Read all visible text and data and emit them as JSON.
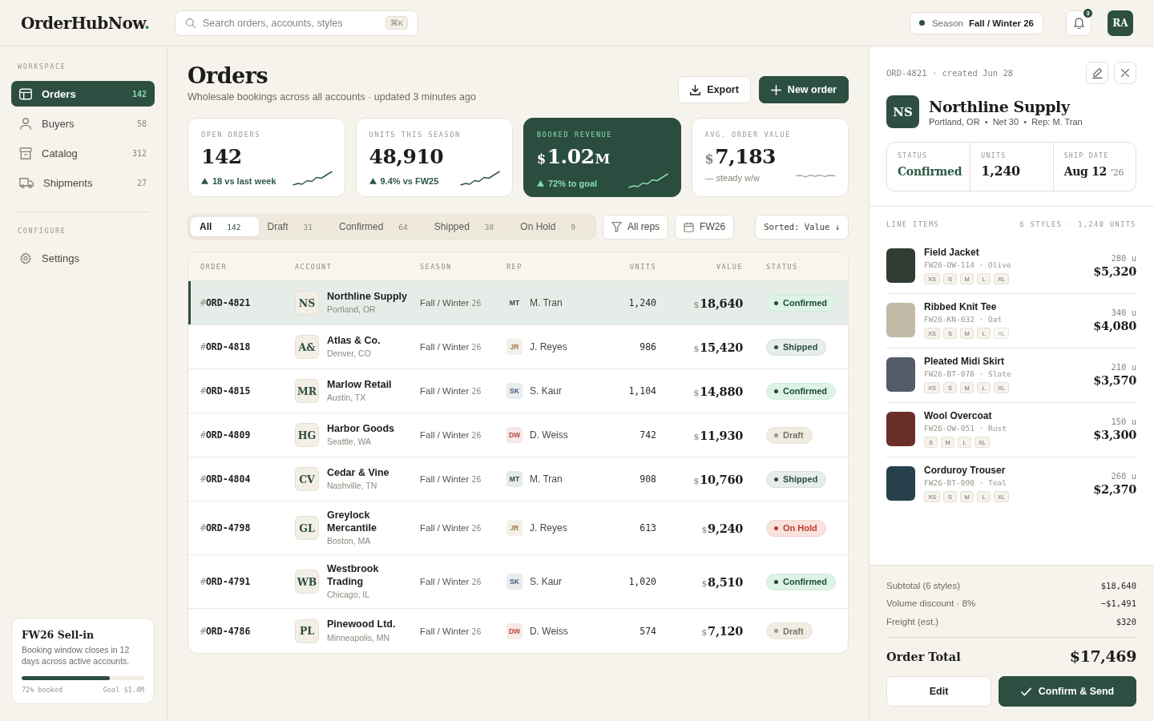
{
  "top_bar": {
    "logo": {
      "name": "OrderHubNow",
      "dot": "."
    },
    "search": {
      "placeholder": "Search orders, accounts, styles",
      "shortcut": "⌘K"
    },
    "season": {
      "label": "Season",
      "value": "Fall / Winter 26"
    },
    "notifications": {
      "count": "3"
    },
    "user": {
      "initials": "RA"
    }
  },
  "sidebar": {
    "sections": [
      {
        "title": "WORKSPACE",
        "items": [
          {
            "label": "Orders",
            "count": "142",
            "selected": true
          },
          {
            "label": "Buyers",
            "count": "58",
            "selected": false
          },
          {
            "label": "Catalog",
            "count": "312",
            "selected": false
          },
          {
            "label": "Shipments",
            "count": "27",
            "selected": false
          }
        ]
      },
      {
        "title": "CONFIGURE",
        "items": [
          {
            "label": "Settings",
            "selected": false
          }
        ]
      }
    ],
    "promo": {
      "title": "FW26 Sell-in",
      "text": "Booking window closes in 12 days across active accounts.",
      "level": 0.72,
      "progress_label": "72% booked",
      "goal": "Goal $1.4M"
    }
  },
  "page": {
    "title": "Orders",
    "subtitle": "Wholesale bookings across all accounts · updated 3 minutes ago",
    "actions": [
      {
        "label": "Export",
        "kind": "export"
      },
      {
        "label": "New order",
        "kind": "create"
      }
    ]
  },
  "kpis": [
    {
      "label": "OPEN ORDERS",
      "value": "142",
      "change": "18 vs last week",
      "kind": "up",
      "highlighted": false
    },
    {
      "label": "UNITS THIS SEASON",
      "value": "48,910",
      "change": "9.4% vs FW25",
      "kind": "up",
      "highlighted": false
    },
    {
      "label": "BOOKED REVENUE",
      "prefix": "$",
      "value": "1.02",
      "suffix": "M",
      "change": "72% to goal",
      "kind": "up",
      "highlighted": true
    },
    {
      "label": "AVG. ORDER VALUE",
      "prefix": "$",
      "value": "7,183",
      "change": "— steady w/w",
      "kind": "flat",
      "highlighted": false
    }
  ],
  "filters": {
    "tabs": [
      {
        "label": "All",
        "count": "142",
        "selected": true
      },
      {
        "label": "Draft",
        "count": "31",
        "selected": false
      },
      {
        "label": "Confirmed",
        "count": "64",
        "selected": false
      },
      {
        "label": "Shipped",
        "count": "38",
        "selected": false
      },
      {
        "label": "On Hold",
        "count": "9",
        "selected": false
      }
    ],
    "buttons": [
      {
        "label": "All reps",
        "kind": "filter"
      },
      {
        "label": "FW26",
        "kind": "date"
      },
      {
        "label": "Sorted: Value ↓",
        "kind": "sort"
      }
    ]
  },
  "table": {
    "columns": [
      "ORDER",
      "ACCOUNT",
      "SEASON",
      "REP",
      "UNITS",
      "VALUE",
      "STATUS"
    ],
    "rows": [
      {
        "order": {
          "prefix": "#",
          "id": "ORD-4821"
        },
        "account": {
          "initials": "NS",
          "name": "Northline Supply",
          "location": "Portland, OR"
        },
        "season": {
          "name": "Fall / Winter",
          "year": "26"
        },
        "rep": {
          "initials": "MT",
          "name": "M. Tran",
          "color": "#2c4f41"
        },
        "units": "1,240",
        "value": {
          "currency": "$",
          "amount": "18,640"
        },
        "status": {
          "label": "Confirmed",
          "kind": "confirmed"
        },
        "selected": true
      },
      {
        "order": {
          "prefix": "#",
          "id": "ORD-4818"
        },
        "account": {
          "initials": "A&",
          "name": "Atlas & Co.",
          "location": "Denver, CO"
        },
        "season": {
          "name": "Fall / Winter",
          "year": "26"
        },
        "rep": {
          "initials": "JR",
          "name": "J. Reyes",
          "color": "#9a7a45"
        },
        "units": "986",
        "value": {
          "currency": "$",
          "amount": "15,420"
        },
        "status": {
          "label": "Shipped",
          "kind": "shipped"
        },
        "selected": false
      },
      {
        "order": {
          "prefix": "#",
          "id": "ORD-4815"
        },
        "account": {
          "initials": "MR",
          "name": "Marlow Retail",
          "location": "Austin, TX"
        },
        "season": {
          "name": "Fall / Winter",
          "year": "26"
        },
        "rep": {
          "initials": "SK",
          "name": "S. Kaur",
          "color": "#3f5d78"
        },
        "units": "1,104",
        "value": {
          "currency": "$",
          "amount": "14,880"
        },
        "status": {
          "label": "Confirmed",
          "kind": "confirmed"
        },
        "selected": false
      },
      {
        "order": {
          "prefix": "#",
          "id": "ORD-4809"
        },
        "account": {
          "initials": "HG",
          "name": "Harbor Goods",
          "location": "Seattle, WA"
        },
        "season": {
          "name": "Fall / Winter",
          "year": "26"
        },
        "rep": {
          "initials": "DW",
          "name": "D. Weiss",
          "color": "#b5483c"
        },
        "units": "742",
        "value": {
          "currency": "$",
          "amount": "11,930"
        },
        "status": {
          "label": "Draft",
          "kind": "draft"
        },
        "selected": false
      },
      {
        "order": {
          "prefix": "#",
          "id": "ORD-4804"
        },
        "account": {
          "initials": "CV",
          "name": "Cedar & Vine",
          "location": "Nashville, TN"
        },
        "season": {
          "name": "Fall / Winter",
          "year": "26"
        },
        "rep": {
          "initials": "MT",
          "name": "M. Tran",
          "color": "#2c4f41"
        },
        "units": "908",
        "value": {
          "currency": "$",
          "amount": "10,760"
        },
        "status": {
          "label": "Shipped",
          "kind": "shipped"
        },
        "selected": false
      },
      {
        "order": {
          "prefix": "#",
          "id": "ORD-4798"
        },
        "account": {
          "initials": "GL",
          "name": "Greylock Mercantile",
          "location": "Boston, MA"
        },
        "season": {
          "name": "Fall / Winter",
          "year": "26"
        },
        "rep": {
          "initials": "JR",
          "name": "J. Reyes",
          "color": "#9a7a45"
        },
        "units": "613",
        "value": {
          "currency": "$",
          "amount": "9,240"
        },
        "status": {
          "label": "On Hold",
          "kind": "hold"
        },
        "selected": false
      },
      {
        "order": {
          "prefix": "#",
          "id": "ORD-4791"
        },
        "account": {
          "initials": "WB",
          "name": "Westbrook Trading",
          "location": "Chicago, IL"
        },
        "season": {
          "name": "Fall / Winter",
          "year": "26"
        },
        "rep": {
          "initials": "SK",
          "name": "S. Kaur",
          "color": "#3f5d78"
        },
        "units": "1,020",
        "value": {
          "currency": "$",
          "amount": "8,510"
        },
        "status": {
          "label": "Confirmed",
          "kind": "confirmed"
        },
        "selected": false
      },
      {
        "order": {
          "prefix": "#",
          "id": "ORD-4786"
        },
        "account": {
          "initials": "PL",
          "name": "Pinewood Ltd.",
          "location": "Minneapolis, MN"
        },
        "season": {
          "name": "Fall / Winter",
          "year": "26"
        },
        "rep": {
          "initials": "DW",
          "name": "D. Weiss",
          "color": "#b5483c"
        },
        "units": "574",
        "value": {
          "currency": "$",
          "amount": "7,120"
        },
        "status": {
          "label": "Draft",
          "kind": "draft"
        },
        "selected": false
      }
    ]
  },
  "detail": {
    "reference": "ORD-4821 · created Jun 28",
    "account": {
      "initials": "NS",
      "name": "Northline Supply",
      "meta": "Portland, OR  •  Net 30  •  Rep: M. Tran"
    },
    "stats": [
      {
        "label": "STATUS",
        "value": "Confirmed",
        "kind": "status"
      },
      {
        "label": "UNITS",
        "value": "1,240",
        "kind": "number"
      },
      {
        "label": "SHIP DATE",
        "value": "Aug 12",
        "suffix": "’26",
        "kind": "date"
      }
    ],
    "line_items_title": "LINE ITEMS",
    "line_items_summary": "6 STYLES · 1,240 UNITS",
    "line_items": [
      {
        "name": "Field Jacket",
        "code": "FW26-OW-114 · Olive",
        "color": "#2f3d33",
        "sizes": [
          {
            "label": "XS",
            "disabled": false
          },
          {
            "label": "S",
            "disabled": false
          },
          {
            "label": "M",
            "disabled": false
          },
          {
            "label": "L",
            "disabled": false
          },
          {
            "label": "XL",
            "disabled": false
          }
        ],
        "units": "280 u",
        "total": "$5,320"
      },
      {
        "name": "Ribbed Knit Tee",
        "code": "FW26-KN-032 · Oat",
        "color": "#c2b9a6",
        "sizes": [
          {
            "label": "XS",
            "disabled": false
          },
          {
            "label": "S",
            "disabled": false
          },
          {
            "label": "M",
            "disabled": false
          },
          {
            "label": "L",
            "disabled": false
          },
          {
            "label": "XL",
            "disabled": true
          }
        ],
        "units": "340 u",
        "total": "$4,080"
      },
      {
        "name": "Pleated Midi Skirt",
        "code": "FW26-BT-078 · Slate",
        "color": "#545b69",
        "sizes": [
          {
            "label": "XS",
            "disabled": false
          },
          {
            "label": "S",
            "disabled": false
          },
          {
            "label": "M",
            "disabled": false
          },
          {
            "label": "L",
            "disabled": false
          },
          {
            "label": "XL",
            "disabled": false
          }
        ],
        "units": "210 u",
        "total": "$3,570"
      },
      {
        "name": "Wool Overcoat",
        "code": "FW26-OW-051 · Rust",
        "color": "#6b2f29",
        "sizes": [
          {
            "label": "S",
            "disabled": false
          },
          {
            "label": "M",
            "disabled": false
          },
          {
            "label": "L",
            "disabled": false
          },
          {
            "label": "XL",
            "disabled": false
          }
        ],
        "units": "150 u",
        "total": "$3,300"
      },
      {
        "name": "Corduroy Trouser",
        "code": "FW26-BT-090 · Teal",
        "color": "#26414b",
        "sizes": [
          {
            "label": "XS",
            "disabled": false
          },
          {
            "label": "S",
            "disabled": false
          },
          {
            "label": "M",
            "disabled": false
          },
          {
            "label": "L",
            "disabled": false
          },
          {
            "label": "XL",
            "disabled": false
          }
        ],
        "units": "260 u",
        "total": "$2,370"
      }
    ],
    "summary": [
      {
        "label": "Subtotal (6 styles)",
        "value": "$18,640"
      },
      {
        "label": "Volume discount · 8%",
        "value": "−$1,491"
      },
      {
        "label": "Freight (est.)",
        "value": "$320"
      }
    ],
    "total": {
      "label": "Order Total",
      "value": "$17,469"
    },
    "actions": [
      {
        "label": "Edit",
        "kind": "edit"
      },
      {
        "label": "Confirm & Send",
        "kind": "confirm"
      }
    ]
  }
}
